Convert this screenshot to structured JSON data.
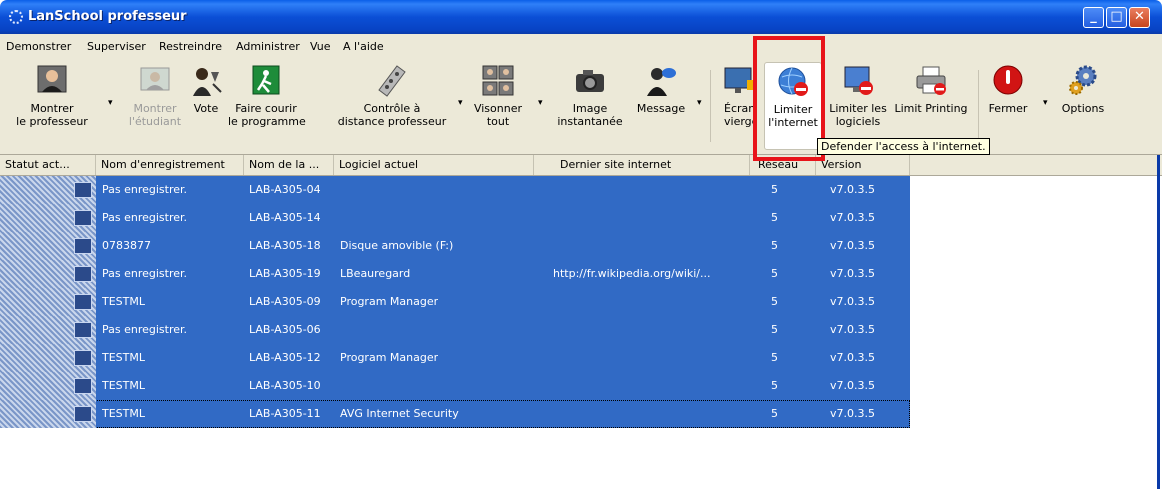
{
  "window": {
    "title": "LanSchool professeur",
    "controls": [
      "_",
      "□",
      "✕"
    ]
  },
  "menu": [
    "Demonstrer",
    "Superviser",
    "Restreindre",
    "Administrer",
    "Vue",
    "A l'aide"
  ],
  "toolbar": [
    {
      "id": "montrer-prof",
      "label1": "Montrer",
      "label2": "le professeur",
      "icon": "teacher-icon",
      "disabled": false
    },
    {
      "id": "montrer-etud",
      "label1": "Montrer",
      "label2": "l'étudiant",
      "icon": "student-icon",
      "disabled": true
    },
    {
      "id": "vote",
      "label1": "Vote",
      "label2": "",
      "icon": "vote-icon",
      "disabled": false
    },
    {
      "id": "faire-courir",
      "label1": "Faire courir",
      "label2": "le programme",
      "icon": "run-program-icon",
      "disabled": false
    },
    {
      "id": "controle",
      "label1": "Contrôle à",
      "label2": "distance professeur",
      "icon": "remote-control-icon",
      "disabled": false
    },
    {
      "id": "visonner",
      "label1": "Visonner",
      "label2": "tout",
      "icon": "view-all-icon",
      "disabled": false
    },
    {
      "id": "image",
      "label1": "Image",
      "label2": "instantanée",
      "icon": "camera-icon",
      "disabled": false
    },
    {
      "id": "message",
      "label1": "Message",
      "label2": "",
      "icon": "message-icon",
      "disabled": false
    },
    {
      "id": "ecran",
      "label1": "Écran",
      "label2": "vierge",
      "icon": "blank-screen-icon",
      "disabled": false
    },
    {
      "id": "limiter-internet",
      "label1": "Limiter",
      "label2": "l'internet",
      "icon": "limit-internet-icon",
      "disabled": false
    },
    {
      "id": "limiter-logiciels",
      "label1": "Limiter les",
      "label2": "logiciels",
      "icon": "limit-software-icon",
      "disabled": false
    },
    {
      "id": "limit-printing",
      "label1": "Limit Printing",
      "label2": "",
      "icon": "printer-icon",
      "disabled": false
    },
    {
      "id": "fermer",
      "label1": "Fermer",
      "label2": "",
      "icon": "shutdown-icon",
      "disabled": false
    },
    {
      "id": "options",
      "label1": "Options",
      "label2": "",
      "icon": "gears-icon",
      "disabled": false
    }
  ],
  "tooltip": "Defender l'access à l'internet.",
  "columns": [
    "Statut act...",
    "Nom d'enregistrement",
    "Nom de la ...",
    "Logiciel actuel",
    "Dernier site internet",
    "Réseau",
    "Version"
  ],
  "rows": [
    {
      "nom": "Pas enregistrer.",
      "machine": "LAB-A305-04",
      "logiciel": "",
      "site": "",
      "reseau": "5",
      "version": "v7.0.3.5"
    },
    {
      "nom": "Pas enregistrer.",
      "machine": "LAB-A305-14",
      "logiciel": "",
      "site": "",
      "reseau": "5",
      "version": "v7.0.3.5"
    },
    {
      "nom": "0783877",
      "machine": "LAB-A305-18",
      "logiciel": "Disque amovible (F:)",
      "site": "",
      "reseau": "5",
      "version": "v7.0.3.5"
    },
    {
      "nom": "Pas enregistrer.",
      "machine": "LAB-A305-19",
      "logiciel": "LBeauregard",
      "site": "http://fr.wikipedia.org/wiki/...",
      "reseau": "5",
      "version": "v7.0.3.5"
    },
    {
      "nom": "TESTML",
      "machine": "LAB-A305-09",
      "logiciel": "Program Manager",
      "site": "",
      "reseau": "5",
      "version": "v7.0.3.5"
    },
    {
      "nom": "Pas enregistrer.",
      "machine": "LAB-A305-06",
      "logiciel": "",
      "site": "",
      "reseau": "5",
      "version": "v7.0.3.5"
    },
    {
      "nom": "TESTML",
      "machine": "LAB-A305-12",
      "logiciel": "Program Manager",
      "site": "",
      "reseau": "5",
      "version": "v7.0.3.5"
    },
    {
      "nom": "TESTML",
      "machine": "LAB-A305-10",
      "logiciel": "",
      "site": "",
      "reseau": "5",
      "version": "v7.0.3.5"
    },
    {
      "nom": "TESTML",
      "machine": "LAB-A305-11",
      "logiciel": "AVG Internet Security",
      "site": "",
      "reseau": "5",
      "version": "v7.0.3.5"
    }
  ]
}
